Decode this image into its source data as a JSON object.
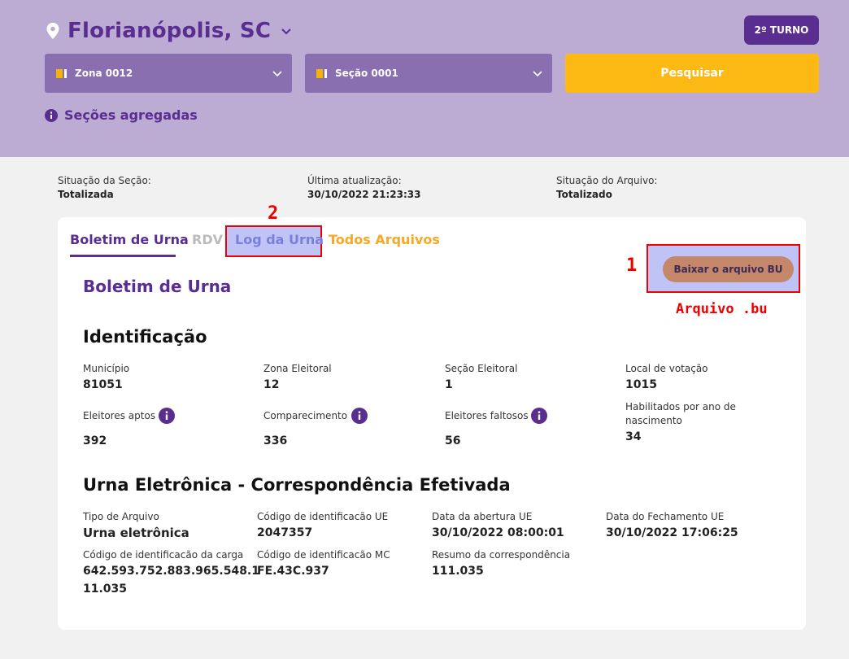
{
  "header": {
    "location": "Florianópolis, SC",
    "turno_label": "2º TURNO",
    "zona_select": "Zona 0012",
    "secao_select": "Seção 0001",
    "search_label": "Pesquisar",
    "aggregated_label": "Seções agregadas"
  },
  "status": {
    "secao_label": "Situação da Seção:",
    "secao_value": "Totalizada",
    "update_label": "Última atualização:",
    "update_value": "30/10/2022 21:23:33",
    "arquivo_label": "Situação do Arquivo:",
    "arquivo_value": "Totalizado"
  },
  "tabs": {
    "boletim": "Boletim de Urna",
    "rdv": "RDV",
    "log": "Log da Urna",
    "todos": "Todos Arquivos"
  },
  "annotations": {
    "one": "1",
    "two": "2",
    "file": "Arquivo .bu"
  },
  "download_label": "Baixar o arquivo BU",
  "section_title": "Boletim de Urna",
  "identificacao": {
    "title": "Identificação",
    "municipio_label": "Município",
    "municipio_value": "81051",
    "zona_label": "Zona Eleitoral",
    "zona_value": "12",
    "secao_label": "Seção Eleitoral",
    "secao_value": "1",
    "local_label": "Local de votação",
    "local_value": "1015",
    "aptos_label": "Eleitores aptos",
    "aptos_value": "392",
    "comparecimento_label": "Comparecimento",
    "comparecimento_value": "336",
    "faltosos_label": "Eleitores faltosos",
    "faltosos_value": "56",
    "habilitados_label_1": "Habilitados por ano de",
    "habilitados_label_2": "nascimento",
    "habilitados_value": "34"
  },
  "urna": {
    "title": "Urna Eletrônica - Correspondência Efetivada",
    "tipo_label": "Tipo de Arquivo",
    "tipo_value": "Urna eletrônica",
    "cod_ue_label": "Código de identificacão UE",
    "cod_ue_value": "2047357",
    "abertura_label": "Data da abertura UE",
    "abertura_value": "30/10/2022 08:00:01",
    "fechamento_label": "Data do Fechamento UE",
    "fechamento_value": "30/10/2022 17:06:25",
    "carga_label": "Código de identificacão da carga",
    "carga_value_1": "642.593.752.883.965.548.1",
    "carga_value_2": "11.035",
    "cod_mc_label": "Código de identificacão MC",
    "cod_mc_value": "FE.43C.937",
    "resumo_label": "Resumo da correspondência",
    "resumo_value": "111.035"
  }
}
